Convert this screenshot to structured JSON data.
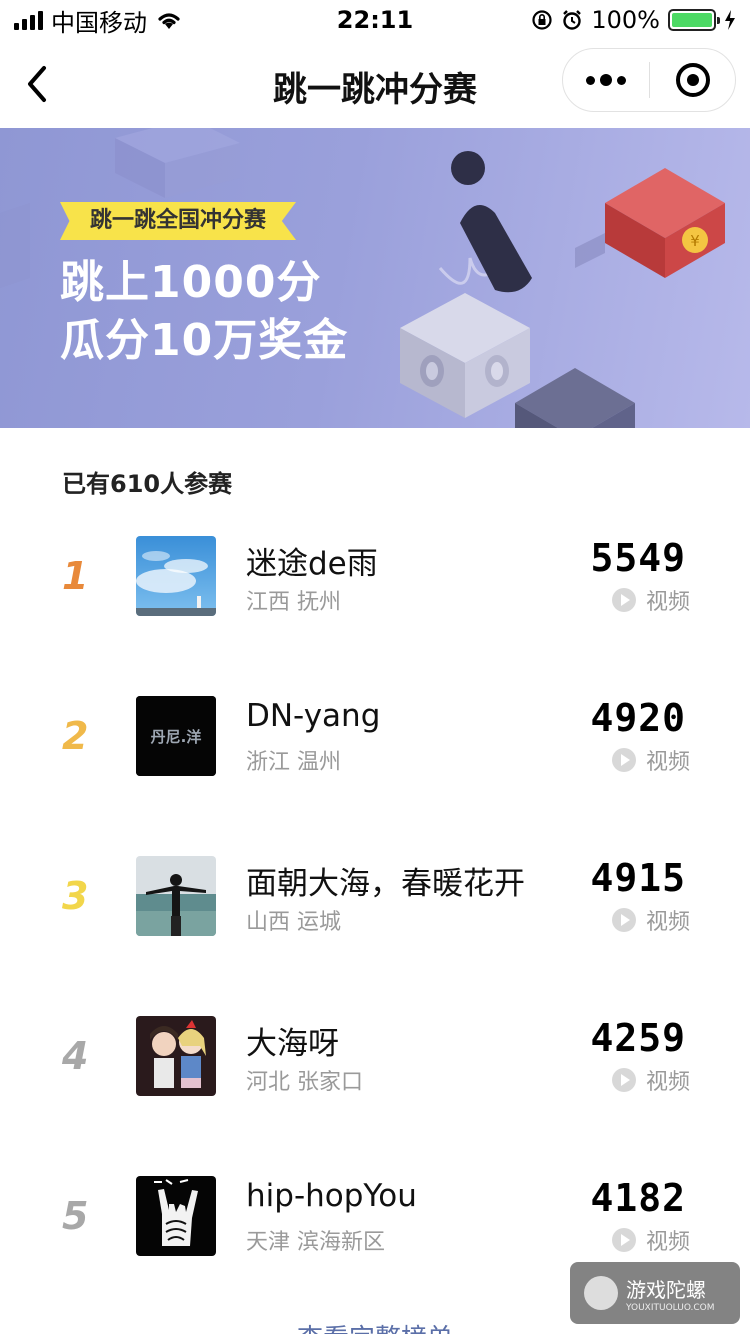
{
  "status_bar": {
    "carrier": "中国移动",
    "time": "22:11",
    "battery_percent": "100%",
    "battery_level": 1.0
  },
  "nav": {
    "title": "跳一跳冲分赛"
  },
  "banner": {
    "tag": "跳一跳全国冲分赛",
    "line1": "跳上1000分",
    "line2": "瓜分10万奖金",
    "coin_symbol": "¥"
  },
  "participants_text": "已有610人参赛",
  "rank_colors": [
    "#e8893a",
    "#f0b94a",
    "#f2d64b",
    "#a8a8a8",
    "#a8a8a8"
  ],
  "ranking": [
    {
      "rank": "1",
      "name": "迷途de雨",
      "location": "江西 抚州",
      "score": "5549",
      "video_label": "视频"
    },
    {
      "rank": "2",
      "name": "DN-yang",
      "location": "浙江 温州",
      "score": "4920",
      "video_label": "视频",
      "avatar_text": "丹尼.洋"
    },
    {
      "rank": "3",
      "name": "面朝大海，春暖花开",
      "location": "山西 运城",
      "score": "4915",
      "video_label": "视频"
    },
    {
      "rank": "4",
      "name": "大海呀",
      "location": "河北 张家口",
      "score": "4259",
      "video_label": "视频"
    },
    {
      "rank": "5",
      "name": "hip-hopYou",
      "location": "天津 滨海新区",
      "score": "4182",
      "video_label": "视频"
    }
  ],
  "view_full_label": "查看完整榜单",
  "watermark": {
    "cn": "游戏陀螺",
    "en": "YOUXITUOLUO.COM"
  }
}
